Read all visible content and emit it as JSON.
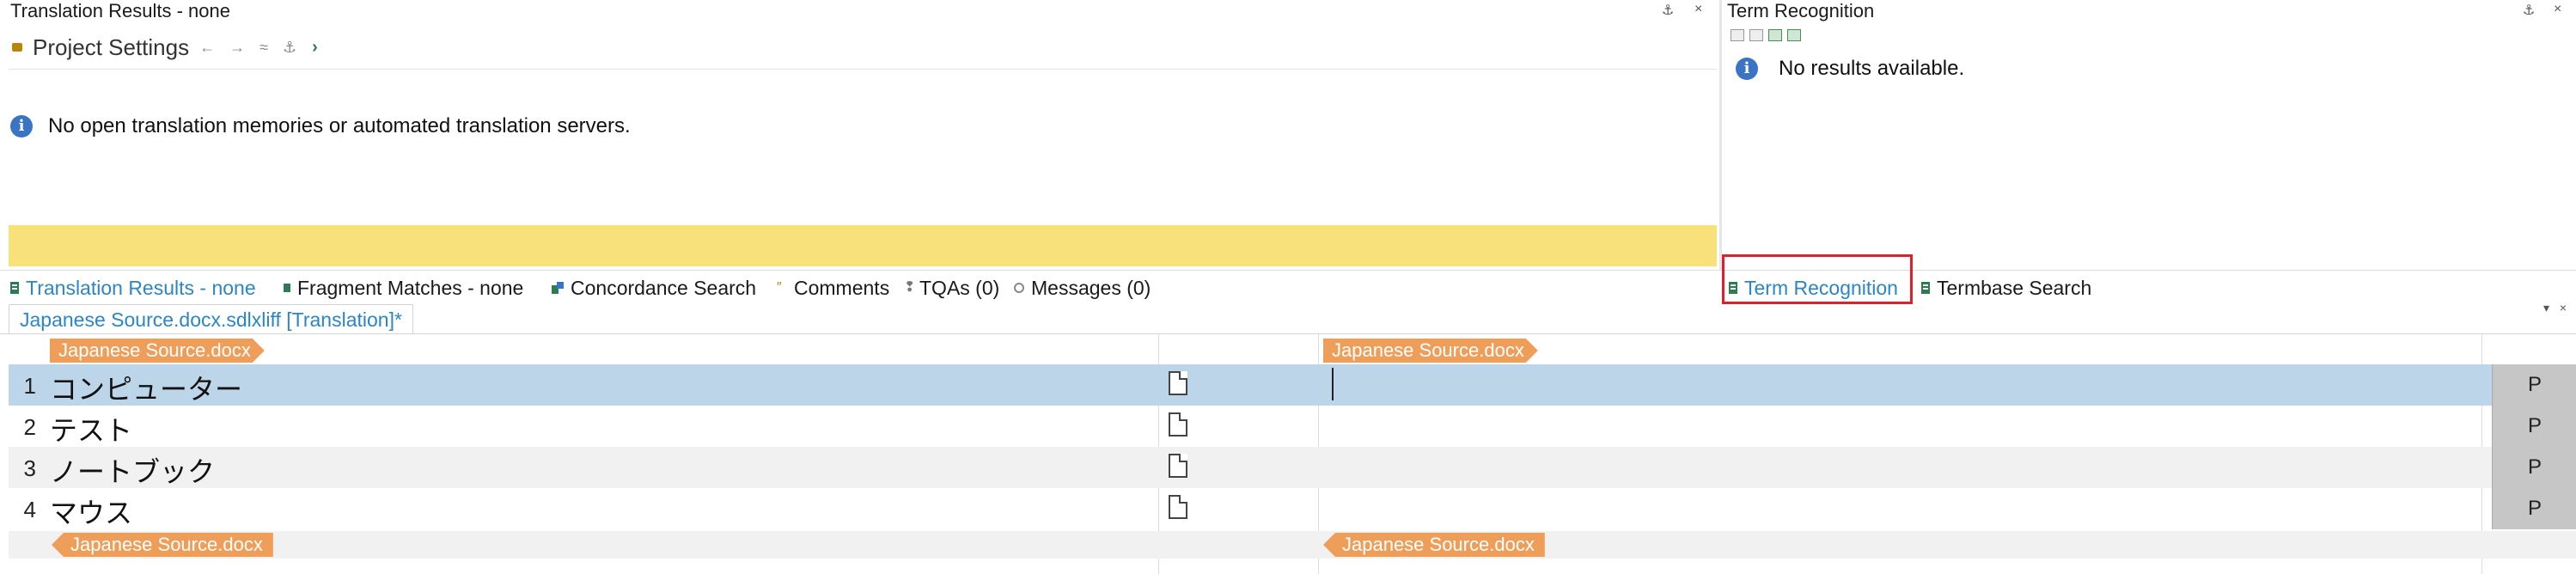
{
  "left_panel": {
    "title": "Translation Results - none",
    "project_settings_label": "Project Settings",
    "project_nav": "← → ≈ ⚓",
    "info_message": "No open translation memories or automated translation servers.",
    "pin_glyph": "⚓",
    "close_glyph": "×"
  },
  "right_panel": {
    "title": "Term Recognition",
    "info_message": "No results available.",
    "pin_glyph": "⚓",
    "close_glyph": "×"
  },
  "tabs": [
    {
      "label": "Translation Results - none",
      "active": true
    },
    {
      "label": "Fragment Matches - none",
      "active": false
    },
    {
      "label": "Concordance Search",
      "active": false
    },
    {
      "label": "Comments",
      "active": false
    },
    {
      "label": "TQAs (0)",
      "active": false
    },
    {
      "label": "Messages (0)",
      "active": false
    },
    {
      "label": "Term Recognition",
      "active": true,
      "highlighted": true
    },
    {
      "label": "Termbase Search",
      "active": false
    }
  ],
  "document_tab": {
    "label": "Japanese Source.docx.sdlxliff [Translation]*",
    "corner_controls": "▾ ×"
  },
  "editor": {
    "source_file_tag": "Japanese Source.docx",
    "target_file_tag": "Japanese Source.docx",
    "segments": [
      {
        "number": "1",
        "source": "コンピューター",
        "target": "",
        "status": "P"
      },
      {
        "number": "2",
        "source": "テスト",
        "target": "",
        "status": "P"
      },
      {
        "number": "3",
        "source": "ノートブック",
        "target": "",
        "status": "P"
      },
      {
        "number": "4",
        "source": "マウス",
        "target": "",
        "status": "P"
      }
    ]
  },
  "colors": {
    "accent_blue": "#2a86c7",
    "selected_row": "#bcd5e8",
    "yellow_bar": "#f8e07a",
    "file_tag": "#ef9e5a",
    "highlight_box": "#e01f2a"
  }
}
